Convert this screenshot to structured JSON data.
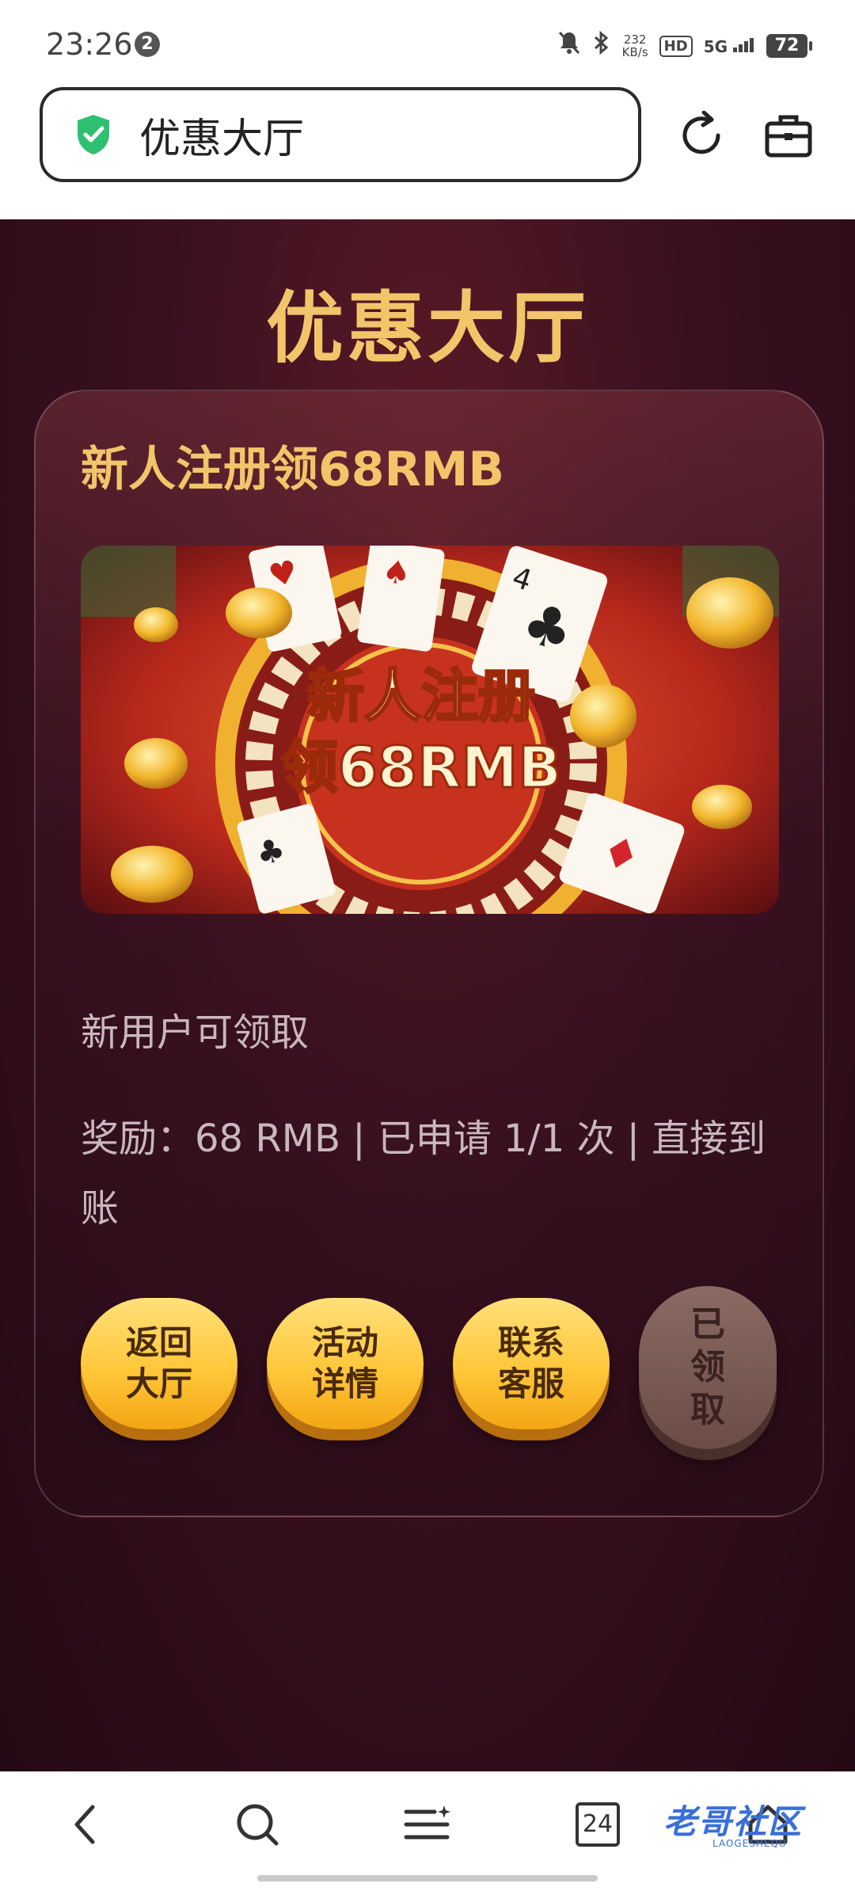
{
  "status_bar": {
    "time": "23:26",
    "notification_count": "2",
    "net_speed_value": "232",
    "net_speed_unit": "KB/s",
    "hd_label": "HD",
    "network": "5G",
    "battery": "72"
  },
  "address_bar": {
    "url_text": "优惠大厅"
  },
  "page": {
    "title": "优惠大厅",
    "card": {
      "title": "新人注册领68RMB",
      "banner_line1": "新人注册",
      "banner_line2": "领68RMB",
      "description": "新用户可领取",
      "info": "奖励：68 RMB | 已申请 1/1 次 | 直接到账",
      "buttons": {
        "back": "返回大厅",
        "details": "活动详情",
        "support": "联系客服",
        "claimed": "已领取"
      }
    }
  },
  "bottom_nav": {
    "tab_count": "24",
    "watermark": "老哥社区",
    "watermark_sub": "LAOGESHEQU"
  },
  "colors": {
    "accent_gold": "#f2c56a",
    "background_maroon": "#3a1020",
    "button_gold": "#ffc73a",
    "button_disabled": "#6b4d46"
  }
}
